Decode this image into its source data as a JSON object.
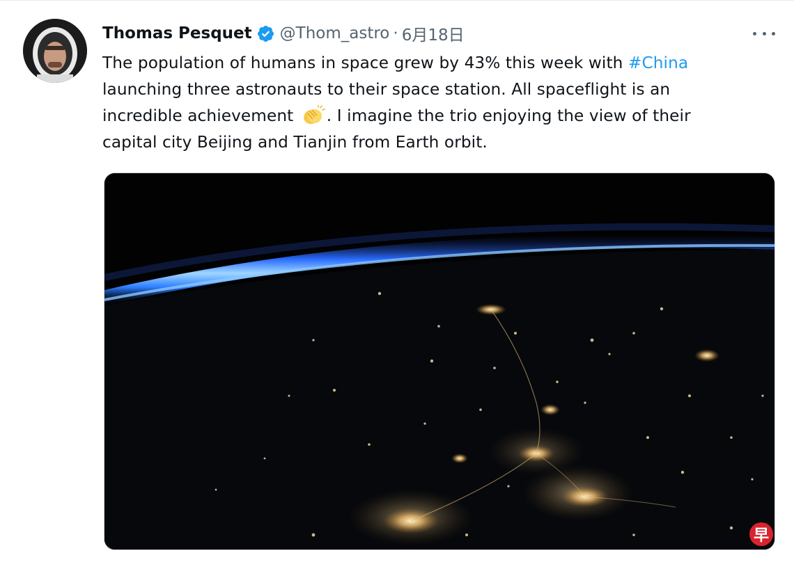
{
  "tweet": {
    "author": {
      "display_name": "Thomas Pesquet",
      "handle": "@Thom_astro",
      "verified": true,
      "avatar_icon": "astronaut-avatar"
    },
    "separator": "·",
    "date": "6月18日",
    "more_icon": "more-icon",
    "text": {
      "line1_before": "The population of humans in space grew by 43% this week with ",
      "hashtag": "#China",
      "line2": "launching three astronauts to their space station. All spaceflight is an",
      "line3_before": "incredible achievement ",
      "emoji_icon": "clapping-hands-icon",
      "line3_after": ". I imagine the trio enjoying the view of their",
      "line4": "capital city Beijing and Tianjin from Earth orbit."
    },
    "media": {
      "icon": "earth-night-photo"
    },
    "colors": {
      "text": "#0f1419",
      "secondary": "#536471",
      "link": "#1d9bf0",
      "verified": "#1d9bf0"
    }
  },
  "watermark": {
    "text": "早",
    "color": "#d9232f"
  }
}
